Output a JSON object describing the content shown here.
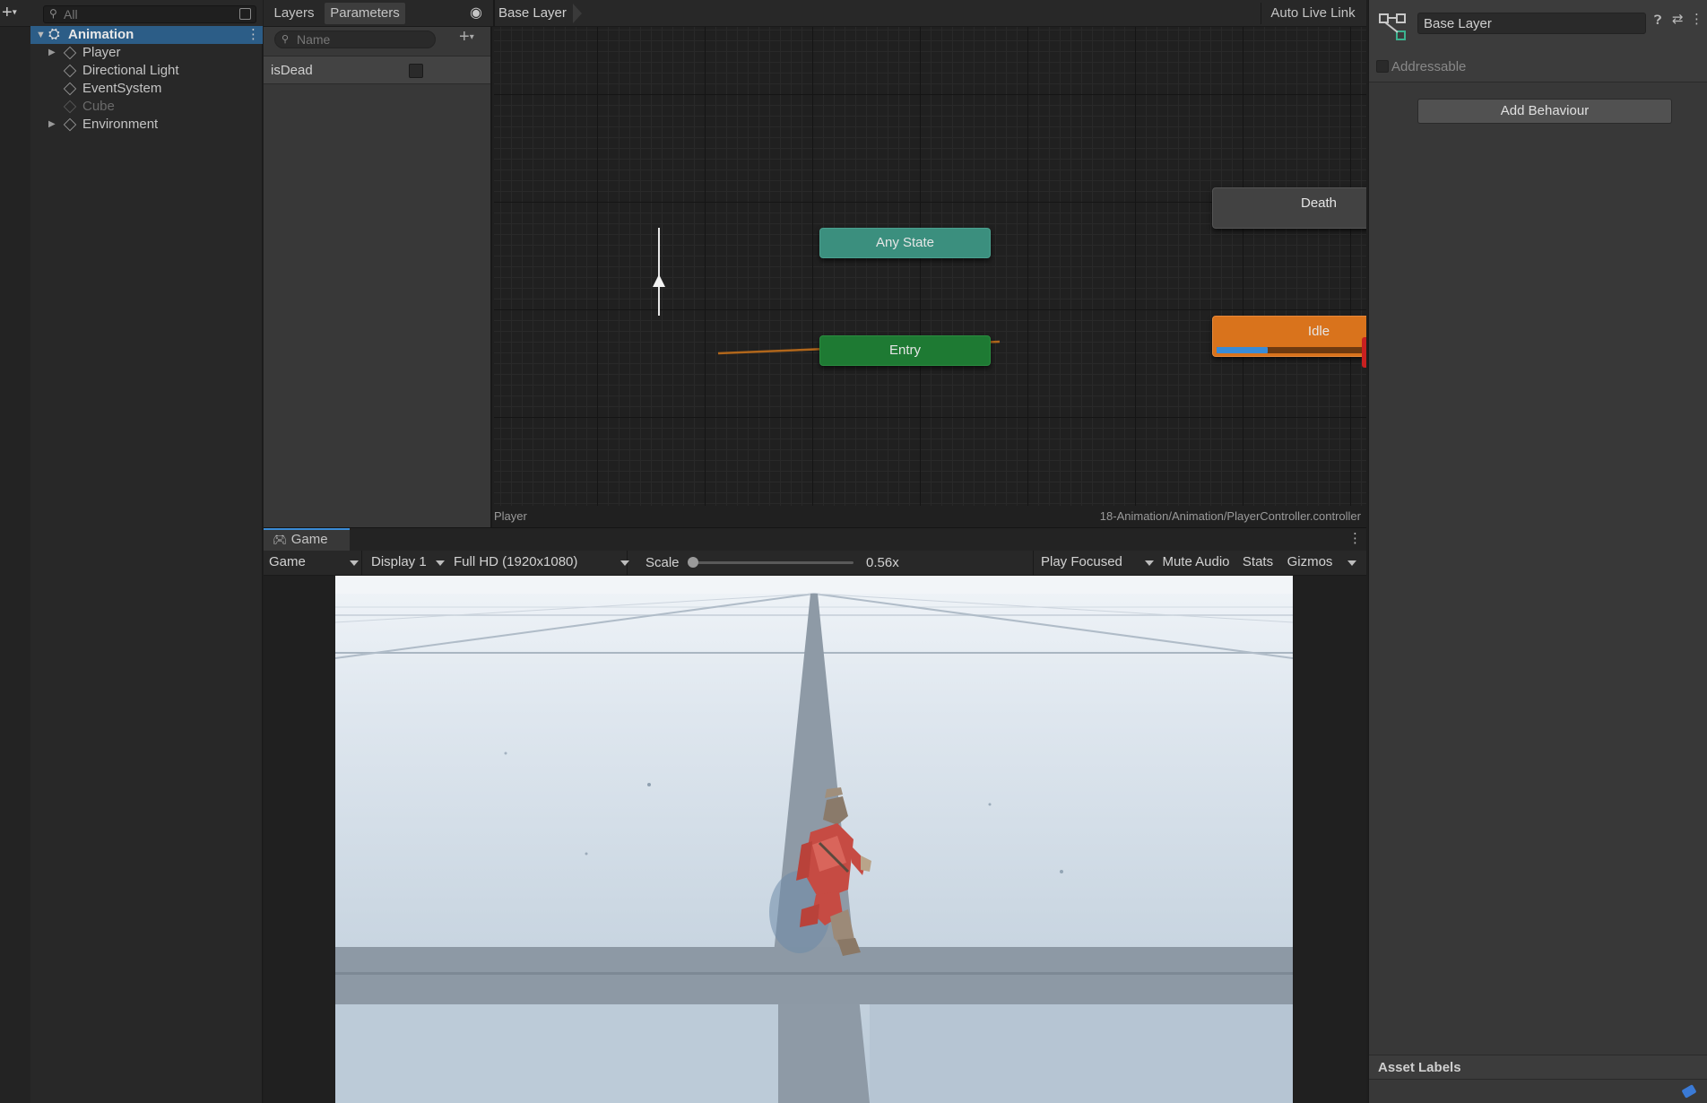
{
  "hierarchy": {
    "search_placeholder": "All",
    "scene_name": "Animation",
    "items": [
      {
        "label": "Player"
      },
      {
        "label": "Directional Light"
      },
      {
        "label": "EventSystem"
      },
      {
        "label": "Cube"
      },
      {
        "label": "Environment"
      }
    ]
  },
  "animator": {
    "tabs": {
      "layers": "Layers",
      "parameters": "Parameters"
    },
    "breadcrumb": "Base Layer",
    "auto_live_link": "Auto Live Link",
    "param_search_placeholder": "Name",
    "parameters": [
      {
        "name": "isDead",
        "value": false
      }
    ],
    "states": {
      "any_state": "Any State",
      "entry": "Entry",
      "death": "Death",
      "idle": "Idle"
    },
    "idle_progress": 0.25,
    "footer_left": "Player",
    "footer_right": "18-Animation/Animation/PlayerController.controller"
  },
  "game": {
    "tab_label": "Game",
    "view_mode": "Game",
    "display": "Display 1",
    "resolution": "Full HD (1920x1080)",
    "scale_label": "Scale",
    "scale_value": "0.56x",
    "play_focus": "Play Focused",
    "mute_audio": "Mute Audio",
    "stats": "Stats",
    "gizmos": "Gizmos"
  },
  "inspector": {
    "title": "Base Layer",
    "addressable": "Addressable",
    "add_behaviour": "Add Behaviour",
    "asset_labels": "Asset Labels"
  },
  "colors": {
    "idle": "#d9731c",
    "entry": "#1e7a33",
    "any_state": "#3b8f7e",
    "death": "#424242",
    "accent": "#3a8bd6"
  }
}
